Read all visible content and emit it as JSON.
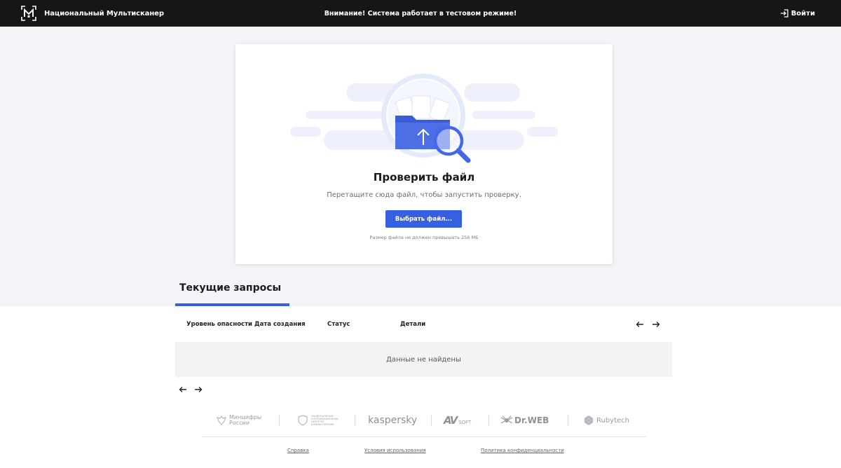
{
  "header": {
    "brand": "Национальный Мультисканер",
    "notice": "Внимание! Система работает в тестовом режиме!",
    "login_label": "Войти"
  },
  "upload": {
    "title": "Проверить файл",
    "description": "Перетащите сюда файл, чтобы запустить проверку.",
    "button_label": "Выбрать файл...",
    "size_note": "Размер файла не должен превышать 256 МБ"
  },
  "requests": {
    "title": "Текущие запросы",
    "columns": [
      "Уровень опасности",
      "Дата создания",
      "Статус",
      "Детали"
    ],
    "empty_text": "Данные не найдены"
  },
  "partners": {
    "mintsifry_line1": "Минцифры",
    "mintsifry_line2": "России",
    "ncc_text": "НАЦИОНАЛЬНЫЙ КООРДИНАЦИОННЫЙ ЦЕНТР ПО КОМПЬЮТЕРНЫМ ИНЦИДЕНТАМ",
    "kaspersky": "kaspersky",
    "avsoft_av": "AV",
    "avsoft_soft": "SOFT",
    "drweb": "Dr.WEB",
    "rubytech": "Rubytech"
  },
  "footer": {
    "links": [
      "Справка",
      "Условия использования",
      "Политика конфиденциальности"
    ]
  },
  "colors": {
    "accent": "#3760e0",
    "header_bg": "#161616",
    "page_bg": "#f3f4f7"
  },
  "icons": {
    "logo": "multiscanner-logo",
    "login": "login-icon",
    "upload": "folder-magnifier-illustration",
    "prev": "arrow-left-icon",
    "next": "arrow-right-icon"
  }
}
